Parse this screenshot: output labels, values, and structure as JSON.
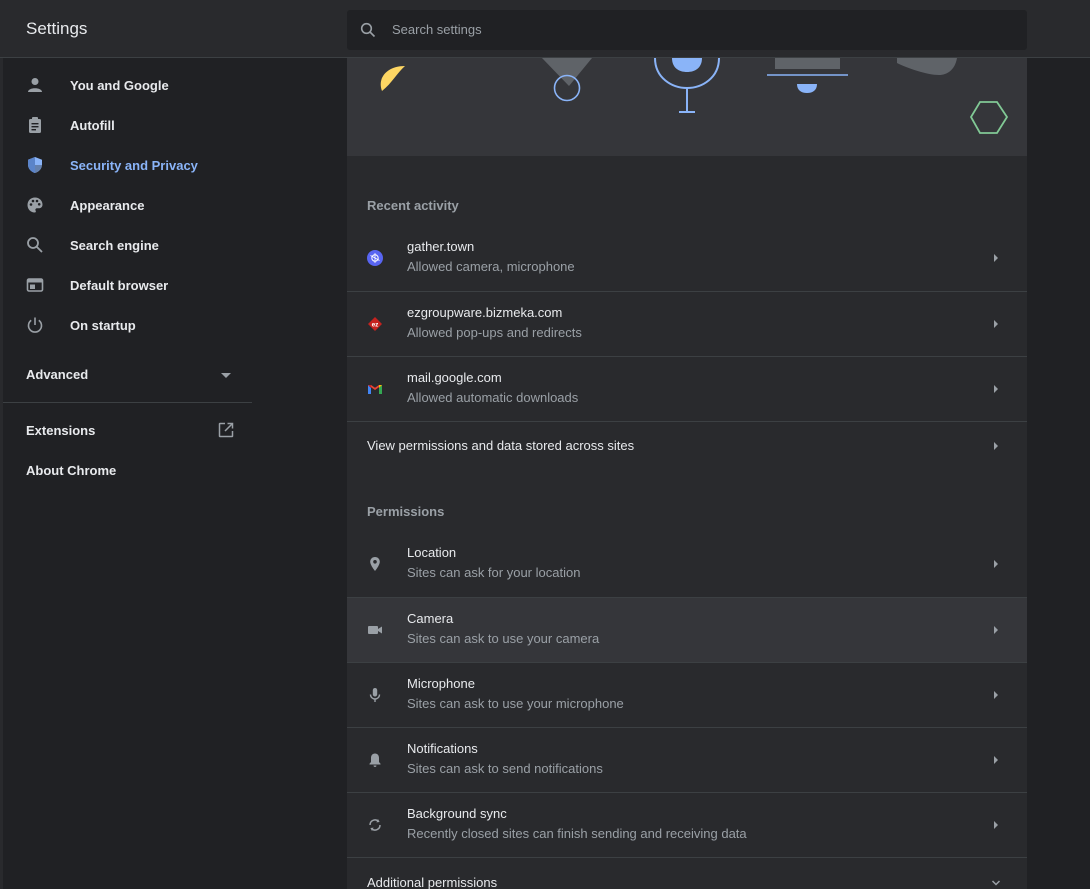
{
  "header": {
    "title": "Settings",
    "search_placeholder": "Search settings"
  },
  "sidebar": {
    "items": [
      {
        "label": "You and Google",
        "icon": "person-icon"
      },
      {
        "label": "Autofill",
        "icon": "clipboard-icon"
      },
      {
        "label": "Security and Privacy",
        "icon": "shield-icon",
        "active": true
      },
      {
        "label": "Appearance",
        "icon": "palette-icon"
      },
      {
        "label": "Search engine",
        "icon": "search-icon"
      },
      {
        "label": "Default browser",
        "icon": "browser-icon"
      },
      {
        "label": "On startup",
        "icon": "power-icon"
      }
    ],
    "advanced_label": "Advanced",
    "extensions_label": "Extensions",
    "about_label": "About Chrome"
  },
  "recent_activity": {
    "title": "Recent activity",
    "rows": [
      {
        "site": "gather.town",
        "detail": "Allowed camera, microphone",
        "icon": "gather-favicon"
      },
      {
        "site": "ezgroupware.bizmeka.com",
        "detail": "Allowed pop-ups and redirects",
        "icon": "ez-favicon",
        "icon_text": "ez"
      },
      {
        "site": "mail.google.com",
        "detail": "Allowed automatic downloads",
        "icon": "gmail-favicon"
      }
    ],
    "view_all_label": "View permissions and data stored across sites"
  },
  "permissions": {
    "title": "Permissions",
    "rows": [
      {
        "name": "Location",
        "detail": "Sites can ask for your location",
        "icon": "location-pin-icon"
      },
      {
        "name": "Camera",
        "detail": "Sites can ask to use your camera",
        "icon": "camera-icon"
      },
      {
        "name": "Microphone",
        "detail": "Sites can ask to use your microphone",
        "icon": "microphone-icon"
      },
      {
        "name": "Notifications",
        "detail": "Sites can ask to send notifications",
        "icon": "bell-icon"
      },
      {
        "name": "Background sync",
        "detail": "Recently closed sites can finish sending and receiving data",
        "icon": "sync-icon"
      }
    ],
    "additional_label": "Additional permissions"
  },
  "colors": {
    "accent": "#8ab4f8",
    "background": "#202124",
    "card": "#292a2d"
  }
}
